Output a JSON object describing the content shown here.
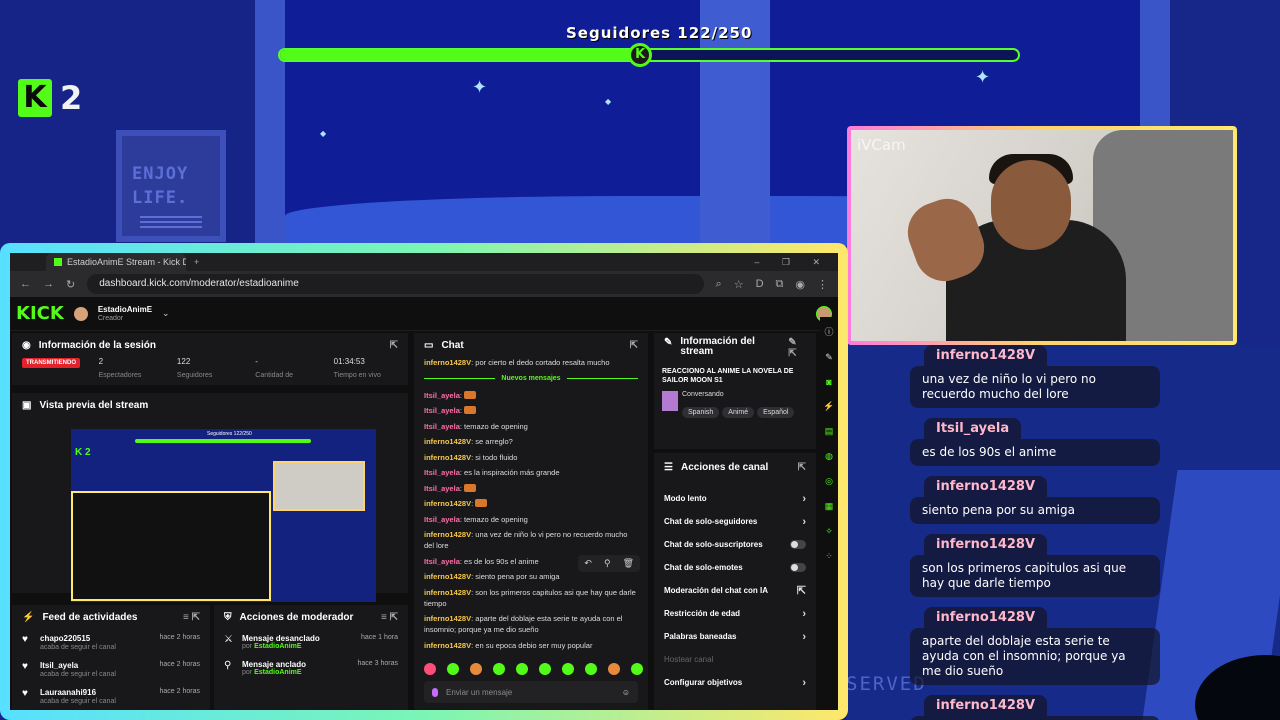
{
  "stream": {
    "goal_label": "Seguidores 122/250",
    "goal_progress": 0.488,
    "kick_count": "2",
    "cam_label": "iVCam",
    "poster_line1": "ENJOY",
    "poster_line2": "LIFE.",
    "served_text": "SERVED"
  },
  "overlay_chat": [
    {
      "user": "inferno1428V",
      "text": "una vez de niño lo vi pero no recuerdo mucho del lore"
    },
    {
      "user": "Itsil_ayela",
      "text": "es de los 90s el anime"
    },
    {
      "user": "inferno1428V",
      "text": "siento pena por su amiga"
    },
    {
      "user": "inferno1428V",
      "text": "son los primeros capitulos asi que hay que darle tiempo"
    },
    {
      "user": "inferno1428V",
      "text": "aparte del doblaje esta serie te ayuda con el insomnio; porque ya me dio sueño"
    },
    {
      "user": "inferno1428V",
      "text": "en su epoca debio ser muy popular"
    }
  ],
  "browser": {
    "tab_title": "EstadioAnimE Stream - Kick Da",
    "url": "dashboard.kick.com/moderator/estadioanime",
    "logo": "KICK",
    "channel_name": "EstadioAnimE",
    "channel_role": "Creador"
  },
  "session": {
    "title": "Información de la sesión",
    "live_label": "TRANSMITIENDO",
    "stats": [
      {
        "value": "2",
        "label": "Espectadores"
      },
      {
        "value": "122",
        "label": "Seguidores"
      },
      {
        "value": "-",
        "label": "Cantidad de"
      },
      {
        "value": "01:34:53",
        "label": "Tiempo en vivo"
      }
    ]
  },
  "preview": {
    "title": "Vista previa del stream",
    "goal_label": "Seguidores 122/250",
    "kick_count": "K 2"
  },
  "activity_feed": {
    "title": "Feed de actividades",
    "items": [
      {
        "user": "chapo220515",
        "sub": "acaba de seguir el canal",
        "time": "hace 2 horas"
      },
      {
        "user": "Itsil_ayela",
        "sub": "acaba de seguir el canal",
        "time": "hace 2 horas"
      },
      {
        "user": "Lauraanahi916",
        "sub": "acaba de seguir el canal",
        "time": "hace 2 horas"
      }
    ]
  },
  "mod_actions": {
    "title": "Acciones de moderador",
    "by_prefix": "por",
    "items": [
      {
        "action": "Mensaje desanclado",
        "by": "EstadioAnimE",
        "time": "hace 1 hora"
      },
      {
        "action": "Mensaje anclado",
        "by": "EstadioAnimE",
        "time": "hace 3 horas"
      }
    ]
  },
  "chat": {
    "title": "Chat",
    "new_messages": "Nuevos mensajes",
    "first_line": {
      "user": "inferno1428V",
      "text": "por cierto el dedo cortado resalta mucho"
    },
    "lines": [
      {
        "user": "Itsil_ayela",
        "text": "",
        "color": "pink"
      },
      {
        "user": "Itsil_ayela",
        "text": "",
        "color": "pink"
      },
      {
        "user": "Itsil_ayela",
        "text": "temazo de opening",
        "color": "pink"
      },
      {
        "user": "inferno1428V",
        "text": "se arreglo?",
        "color": "gold"
      },
      {
        "user": "inferno1428V",
        "text": "si todo fluido",
        "color": "gold"
      },
      {
        "user": "Itsil_ayela",
        "text": "es la inspiración más grande",
        "color": "pink"
      },
      {
        "user": "Itsil_ayela",
        "text": "",
        "color": "pink"
      },
      {
        "user": "inferno1428V",
        "text": "",
        "color": "gold"
      },
      {
        "user": "Itsil_ayela",
        "text": "temazo de opening",
        "color": "pink"
      },
      {
        "user": "inferno1428V",
        "text": "una vez de niño lo vi pero no recuerdo mucho del lore",
        "color": "gold"
      },
      {
        "user": "Itsil_ayela",
        "text": "es de los 90s el anime",
        "color": "pink"
      },
      {
        "user": "inferno1428V",
        "text": "siento pena por su amiga",
        "color": "gold"
      },
      {
        "user": "inferno1428V",
        "text": "son los primeros capitulos asi que hay que darle tiempo",
        "color": "gold"
      },
      {
        "user": "inferno1428V",
        "text": "aparte del doblaje esta serie te ayuda con el insomnio; porque ya me dio sueño",
        "color": "gold"
      },
      {
        "user": "inferno1428V",
        "text": "en su epoca debio ser muy popular",
        "color": "gold"
      }
    ],
    "input_placeholder": "Enviar un mensaje"
  },
  "stream_info": {
    "title": "Información del stream",
    "stream_title": "REACCIONO AL ANIME LA NOVELA DE SAILOR MOON S1",
    "category": "Conversando",
    "tags": [
      "Spanish",
      "Animé",
      "Español"
    ]
  },
  "channel_actions": {
    "title": "Acciones de canal",
    "items": [
      {
        "label": "Modo lento",
        "kind": "chevron"
      },
      {
        "label": "Chat de solo-seguidores",
        "kind": "chevron"
      },
      {
        "label": "Chat de solo-suscriptores",
        "kind": "toggle"
      },
      {
        "label": "Chat de solo-emotes",
        "kind": "toggle"
      },
      {
        "label": "Moderación del chat con IA",
        "kind": "external"
      },
      {
        "label": "Restricción de edad",
        "kind": "chevron"
      },
      {
        "label": "Palabras baneadas",
        "kind": "chevron"
      },
      {
        "label": "Hostear canal",
        "kind": "muted"
      },
      {
        "label": "Configurar objetivos",
        "kind": "chevron"
      }
    ]
  },
  "colors": {
    "kick_green": "#53fc18",
    "live_red": "#e5212c",
    "gold_user": "#f7c948",
    "pink_user": "#ff6fa9"
  }
}
